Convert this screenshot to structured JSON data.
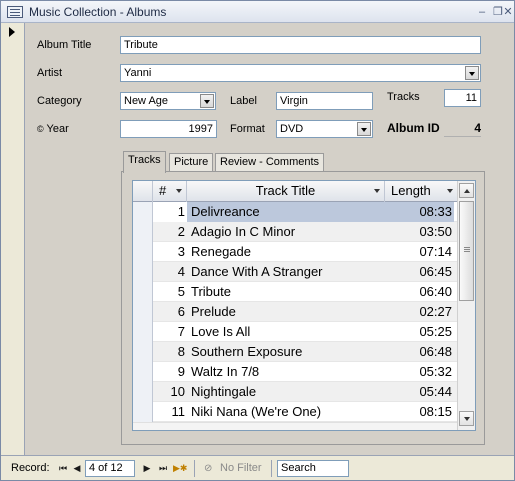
{
  "window": {
    "title": "Music Collection - Albums"
  },
  "form": {
    "album_title_label": "Album Title",
    "album_title_value": "Tribute",
    "artist_label": "Artist",
    "artist_value": "Yanni",
    "category_label": "Category",
    "category_value": "New Age",
    "label_label": "Label",
    "label_value": "Virgin",
    "tracks_label": "Tracks",
    "tracks_value": "11",
    "year_label": "Year",
    "year_value": "1997",
    "format_label": "Format",
    "format_value": "DVD",
    "album_id_label": "Album ID",
    "album_id_value": "4"
  },
  "tabs": [
    {
      "label": "Tracks"
    },
    {
      "label": "Picture"
    },
    {
      "label": "Review - Comments"
    }
  ],
  "grid": {
    "columns": {
      "num": "#",
      "title": "Track Title",
      "length": "Length"
    },
    "rows": [
      {
        "num": "1",
        "title": "Delivreance",
        "length": "08:33"
      },
      {
        "num": "2",
        "title": "Adagio In C Minor",
        "length": "03:50"
      },
      {
        "num": "3",
        "title": "Renegade",
        "length": "07:14"
      },
      {
        "num": "4",
        "title": "Dance With A Stranger",
        "length": "06:45"
      },
      {
        "num": "5",
        "title": "Tribute",
        "length": "06:40"
      },
      {
        "num": "6",
        "title": "Prelude",
        "length": "02:27"
      },
      {
        "num": "7",
        "title": "Love Is All",
        "length": "05:25"
      },
      {
        "num": "8",
        "title": "Southern Exposure",
        "length": "06:48"
      },
      {
        "num": "9",
        "title": "Waltz In 7/8",
        "length": "05:32"
      },
      {
        "num": "10",
        "title": "Nightingale",
        "length": "05:44"
      },
      {
        "num": "11",
        "title": "Niki Nana (We're One)",
        "length": "08:15"
      }
    ]
  },
  "navigation": {
    "record_label": "Record:",
    "position": "4 of 12",
    "no_filter": "No Filter",
    "search_placeholder": "Search"
  }
}
